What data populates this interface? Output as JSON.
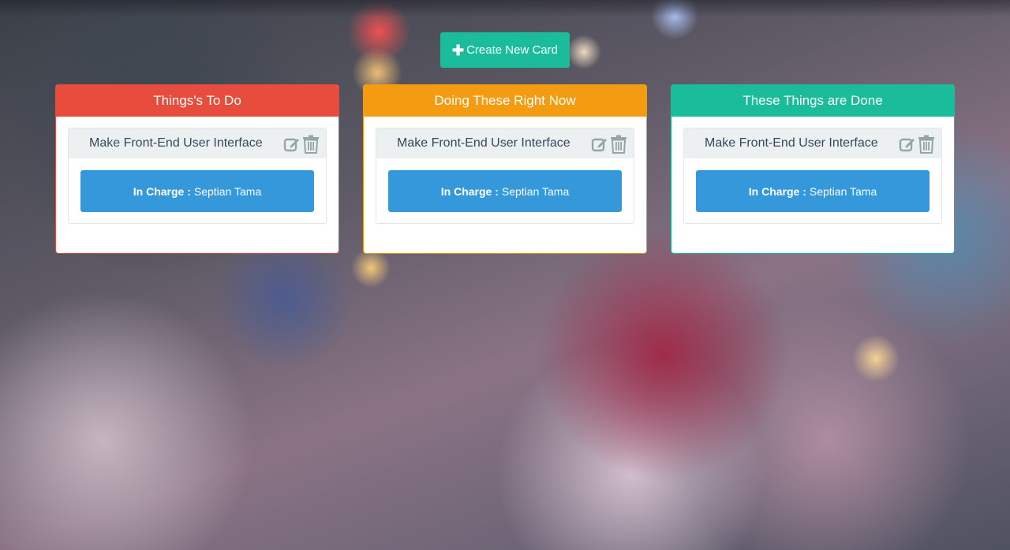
{
  "toolbar": {
    "create_label": "Create New Card"
  },
  "columns": [
    {
      "title": "Things's To Do",
      "color": "#e74c3c",
      "card": {
        "title": "Make Front-End User Interface",
        "in_charge_label": "In Charge :",
        "in_charge_name": "Septian Tama"
      }
    },
    {
      "title": "Doing These Right Now",
      "color": "#f39c12",
      "card": {
        "title": "Make Front-End User Interface",
        "in_charge_label": "In Charge :",
        "in_charge_name": "Septian Tama"
      }
    },
    {
      "title": "These Things are Done",
      "color": "#1abc9c",
      "card": {
        "title": "Make Front-End User Interface",
        "in_charge_label": "In Charge :",
        "in_charge_name": "Septian Tama"
      }
    }
  ],
  "colors": {
    "accent": "#1abc9c",
    "in_charge_bg": "#3498db",
    "card_header_bg": "#ecf0f1",
    "icon_gray": "#95a5a6"
  },
  "icons": {
    "create": "plus-icon",
    "edit": "edit-icon",
    "delete": "trash-icon"
  }
}
